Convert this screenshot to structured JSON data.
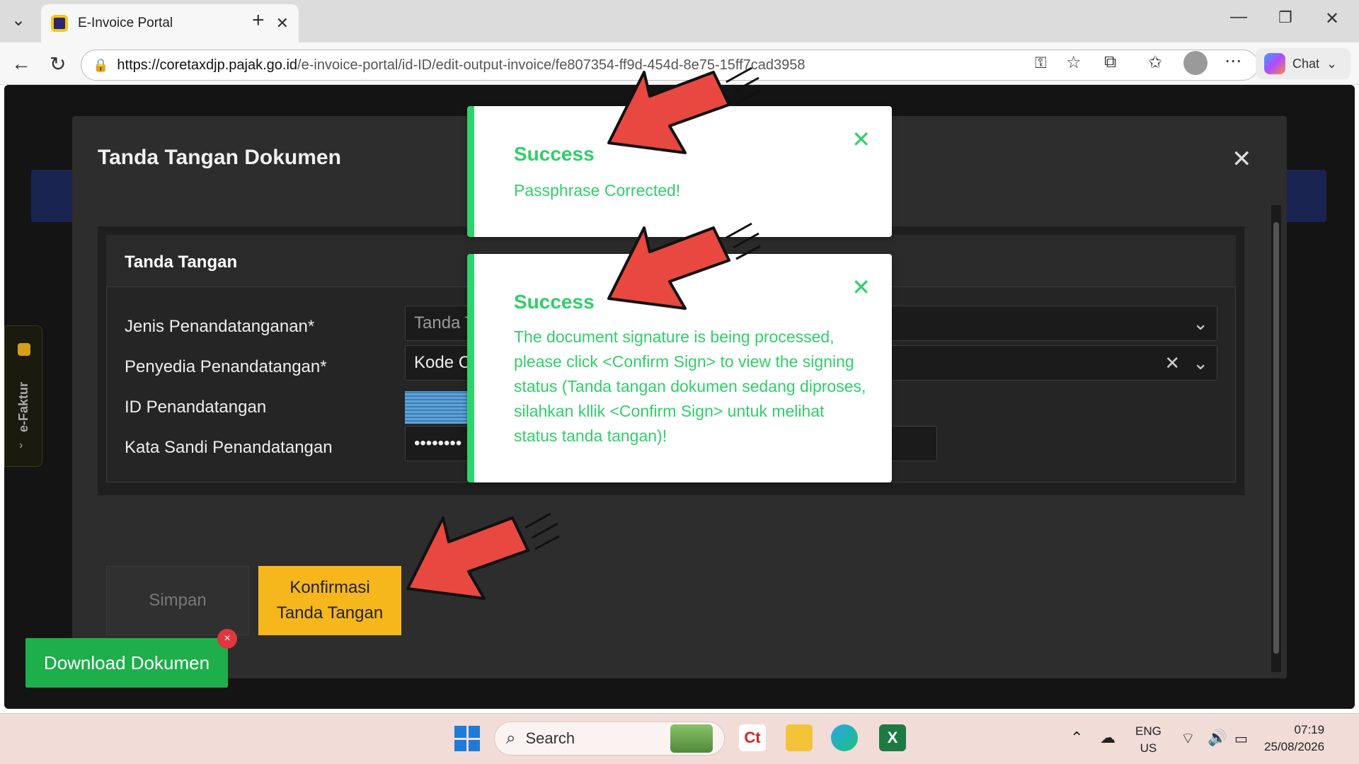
{
  "browser": {
    "tab_title": "E-Invoice Portal",
    "url_domain": "https://coretaxdjp.pajak.go.id",
    "url_path": "/e-invoice-portal/id-ID/edit-output-invoice/fe807354-ff9d-454d-8e75-15ff7cad3958",
    "chat_label": "Chat"
  },
  "sidebar": {
    "label": "e-Faktur"
  },
  "modal": {
    "title": "Tanda Tangan Dokumen",
    "panel_title": "Tanda Tangan",
    "fields": [
      {
        "label": "Jenis Penandatanganan*",
        "value": "Tanda T"
      },
      {
        "label": "Penyedia Penandatangan*",
        "value": "Kode C"
      },
      {
        "label": "ID Penandatangan",
        "value": ""
      },
      {
        "label": "Kata Sandi Penandatangan",
        "value": "••••••••"
      }
    ],
    "buttons": {
      "save": "Simpan",
      "confirm": "Konfirmasi Tanda Tangan"
    }
  },
  "download": {
    "label": "Download Dokumen",
    "close": "×"
  },
  "toasts": [
    {
      "title": "Success",
      "message": "Passphrase Corrected!"
    },
    {
      "title": "Success",
      "message": "The document signature is being processed, please click <Confirm Sign> to view the signing status (Tanda tangan dokumen sedang diproses, silahkan kllik <Confirm Sign> untuk melihat status tanda tangan)!"
    }
  ],
  "taskbar": {
    "search_placeholder": "Search",
    "lang_top": "ENG",
    "lang_bottom": "US",
    "time": "07:19",
    "date": "25/08/2026"
  },
  "colors": {
    "success": "#2fcf6a",
    "confirm_button": "#f6b71c",
    "download_button": "#1eae4b"
  }
}
